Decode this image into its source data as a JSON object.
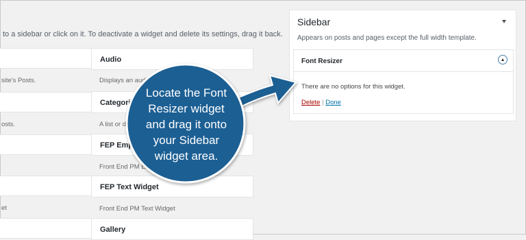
{
  "available": {
    "intro": "to a sidebar or click on it. To deactivate a widget and delete its settings, drag it back.",
    "left_descs": [
      "site's Posts.",
      "osts.",
      "et"
    ],
    "widgets": [
      {
        "title": "Audio",
        "desc": "Displays an audio"
      },
      {
        "title": "Categories",
        "desc": "A list or dr"
      },
      {
        "title": "FEP Empty",
        "desc": "Front End PM Empty"
      },
      {
        "title": "FEP Text Widget",
        "desc": "Front End PM Text Widget"
      },
      {
        "title": "Gallery",
        "desc": ""
      }
    ]
  },
  "sidebar": {
    "title": "Sidebar",
    "description": "Appears on posts and pages except the full width template.",
    "widget": {
      "title": "Font Resizer",
      "message": "There are no options for this widget.",
      "delete_label": "Delete",
      "separator": "|",
      "done_label": "Done"
    }
  },
  "callout": {
    "lines": [
      "Locate the Font",
      "Resizer widget",
      "and drag it onto",
      "your Sidebar",
      "widget area."
    ],
    "color": "#1f5f93"
  }
}
